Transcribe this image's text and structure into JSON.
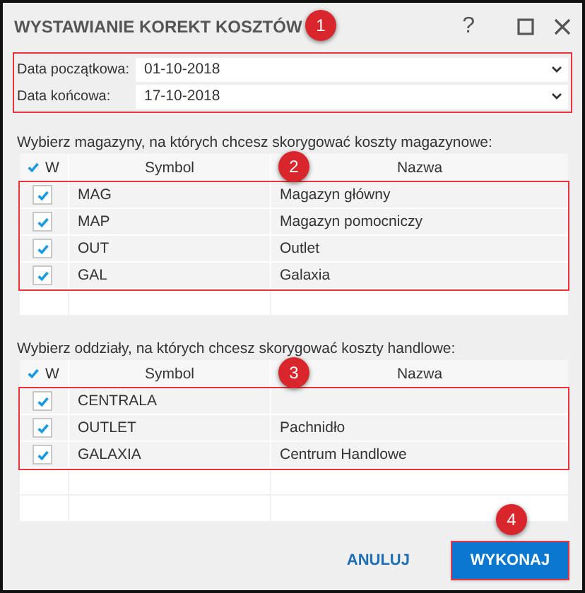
{
  "window": {
    "title": "WYSTAWIANIE KOREKT KOSZTÓW",
    "help_label": "?"
  },
  "dates": {
    "badge": "1",
    "highlighted": true,
    "fields": [
      {
        "label": "Data początkowa:",
        "value": "01-10-2018"
      },
      {
        "label": "Data końcowa:",
        "value": "17-10-2018"
      }
    ]
  },
  "warehouses": {
    "prompt": "Wybierz magazyny, na których chcesz skorygować koszty magazynowe:",
    "badge": "2",
    "highlighted": true,
    "columns": [
      "W",
      "Symbol",
      "Nazwa"
    ],
    "all_checked": true,
    "rows": [
      {
        "symbol": "MAG",
        "name": "Magazyn główny",
        "checked": true
      },
      {
        "symbol": "MAP",
        "name": "Magazyn pomocniczy",
        "checked": true
      },
      {
        "symbol": "OUT",
        "name": "Outlet",
        "checked": true
      },
      {
        "symbol": "GAL",
        "name": "Galaxia",
        "checked": true
      }
    ]
  },
  "branches": {
    "prompt": "Wybierz oddziały, na których chcesz skorygować koszty handlowe:",
    "badge": "3",
    "highlighted": true,
    "columns": [
      "W",
      "Symbol",
      "Nazwa"
    ],
    "all_checked": true,
    "rows": [
      {
        "symbol": "CENTRALA",
        "checked": true
      },
      {
        "symbol": "OUTLET",
        "name": "Pachnidło",
        "checked": true
      },
      {
        "symbol": "GALAXIA",
        "name": "Centrum Handlowe",
        "checked": true
      }
    ]
  },
  "buttons": [
    {
      "label": "ANULUJ",
      "kind": "link"
    },
    {
      "label": "WYKONAJ",
      "kind": "primary",
      "badge": "4",
      "highlighted": true
    }
  ]
}
